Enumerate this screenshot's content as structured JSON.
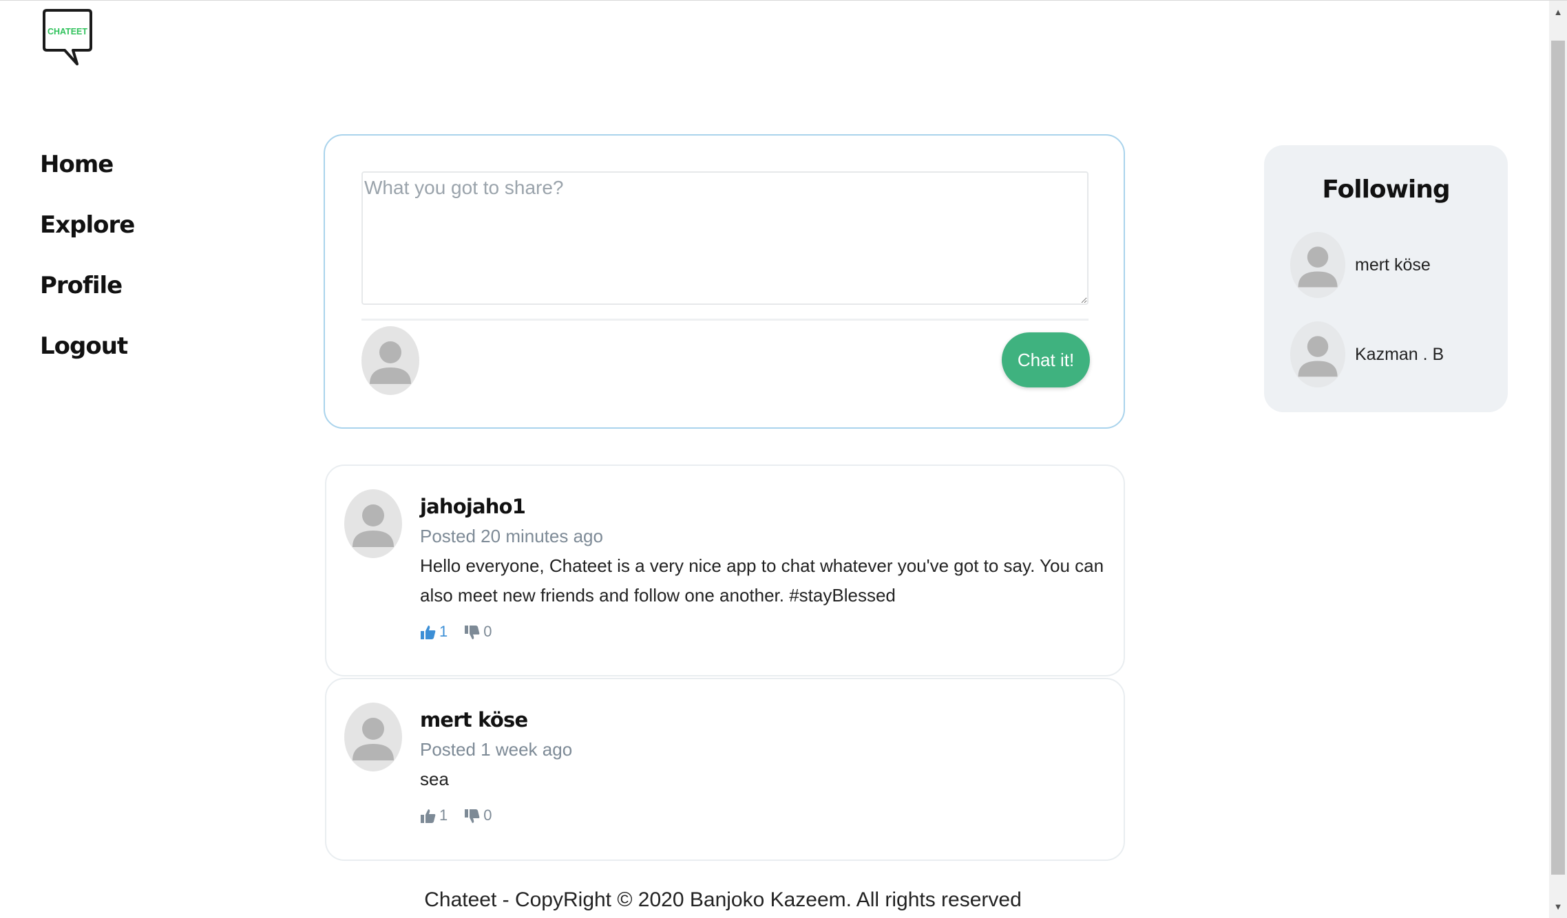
{
  "logo": {
    "text": "CHATEET",
    "icon": "speech-bubble-logo"
  },
  "nav": {
    "items": [
      {
        "label": "Home"
      },
      {
        "label": "Explore"
      },
      {
        "label": "Profile"
      },
      {
        "label": "Logout"
      }
    ]
  },
  "composer": {
    "placeholder": "What you got to share?",
    "value": "",
    "submit_label": "Chat it!"
  },
  "posts": [
    {
      "author": "jahojaho1",
      "posted": "Posted 20 minutes ago",
      "content": "Hello everyone, Chateet is a very nice app to chat whatever you've got to say. You can also meet new friends and follow one another. #stayBlessed",
      "likes": "1",
      "dislikes": "0",
      "liked": true
    },
    {
      "author": "mert köse",
      "posted": "Posted 1 week ago",
      "content": "sea",
      "likes": "1",
      "dislikes": "0",
      "liked": false
    }
  ],
  "following": {
    "title": "Following",
    "users": [
      {
        "name": "mert köse"
      },
      {
        "name": "Kazman . B"
      }
    ]
  },
  "footer": {
    "text": "Chateet - CopyRight © 2020 Banjoko Kazeem. All rights reserved"
  },
  "colors": {
    "accent_green": "#3fb27f",
    "logo_green": "#2fc25b",
    "like_blue": "#3c8fd6",
    "composer_border": "#a9d3ec",
    "following_bg": "#eef1f4"
  }
}
